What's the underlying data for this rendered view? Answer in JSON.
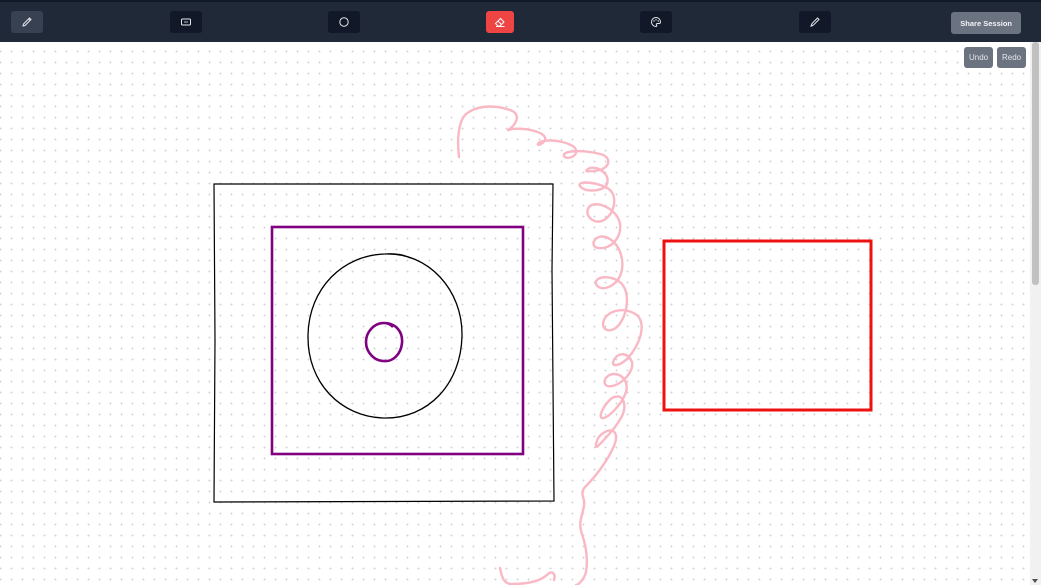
{
  "toolbar": {
    "tools": [
      {
        "icon": "pencil-icon"
      },
      {
        "icon": "rectangle-icon"
      },
      {
        "icon": "circle-icon"
      },
      {
        "icon": "eraser-icon",
        "active": true
      },
      {
        "icon": "palette-icon"
      },
      {
        "icon": "brush-icon"
      }
    ],
    "share_label": "Share Session"
  },
  "history": {
    "undo_label": "Undo",
    "redo_label": "Redo"
  },
  "colors": {
    "toolbar_bg": "#1f2937",
    "active_tool": "#ef4444",
    "stroke_black": "#000000",
    "stroke_purple": "#800080",
    "stroke_red": "#ee1111",
    "stroke_pink": "#f9b8c4"
  }
}
